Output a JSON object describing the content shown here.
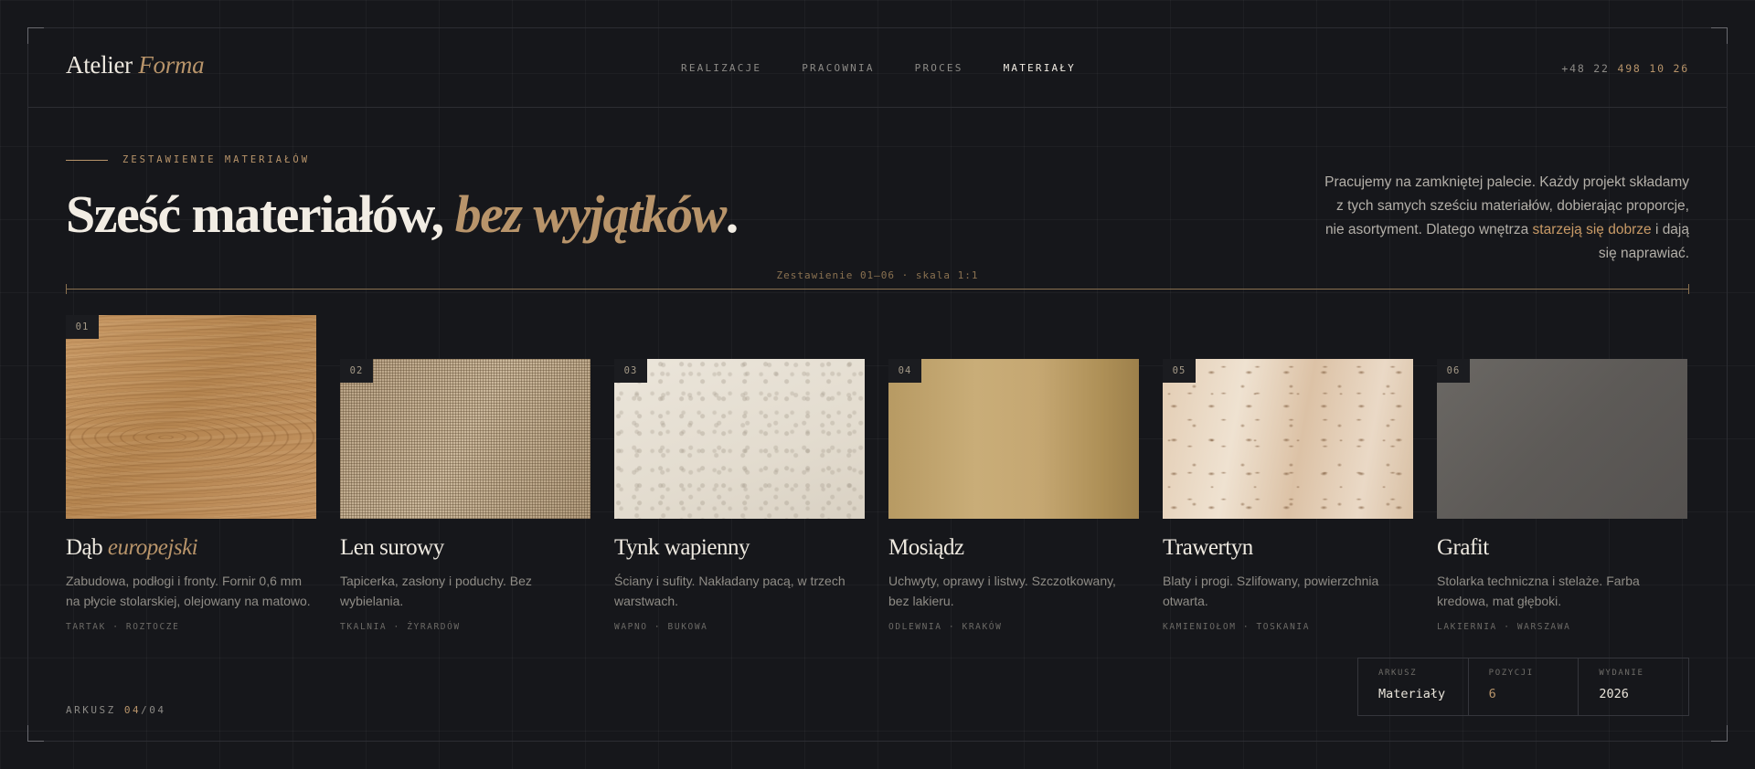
{
  "brand": {
    "name": "Atelier",
    "name_accent": "Forma"
  },
  "nav": {
    "items": [
      {
        "label": "REALIZACJE",
        "active": false
      },
      {
        "label": "PRACOWNIA",
        "active": false
      },
      {
        "label": "PROCES",
        "active": false
      },
      {
        "label": "MATERIAŁY",
        "active": true
      }
    ]
  },
  "phone": {
    "prefix": "+48 22",
    "number": "498 10 26"
  },
  "intro": {
    "eyebrow": "ZESTAWIENIE MATERIAŁÓW",
    "headline_main": "Sześć materiałów,",
    "headline_accent": "bez wyjątków",
    "headline_end": ".",
    "lede_before": "Pracujemy na zamkniętej palecie. Każdy projekt składamy z tych samych sześciu materiałów, dobierając proporcje, nie asortyment. Dlatego wnętrza",
    "lede_accent": "starzeją się dobrze",
    "lede_after": "i dają się naprawiać."
  },
  "ruler": {
    "label": "Zestawienie 01–06 · skala 1:1"
  },
  "materials": [
    {
      "num": "01",
      "title": "Dąb",
      "title_accent": "europejski",
      "desc": "Zabudowa, podłogi i fronty. Fornir 0,6 mm na płycie stolarskiej, olejowany na matowo.",
      "meta": "TARTAK · ROZTOCZE",
      "texture": "oak"
    },
    {
      "num": "02",
      "title": "Len surowy",
      "title_accent": "",
      "desc": "Tapicerka, zasłony i poduchy. Bez wybielania.",
      "meta": "TKALNIA · ŻYRARDÓW",
      "texture": "linen"
    },
    {
      "num": "03",
      "title": "Tynk wapienny",
      "title_accent": "",
      "desc": "Ściany i sufity. Nakładany pacą, w trzech warstwach.",
      "meta": "WAPNO · BUKOWA",
      "texture": "plaster"
    },
    {
      "num": "04",
      "title": "Mosiądz",
      "title_accent": "",
      "desc": "Uchwyty, oprawy i listwy. Szczotkowany, bez lakieru.",
      "meta": "ODLEWNIA · KRAKÓW",
      "texture": "brass"
    },
    {
      "num": "05",
      "title": "Trawertyn",
      "title_accent": "",
      "desc": "Blaty i progi. Szlifowany, powierzchnia otwarta.",
      "meta": "KAMIENIOŁOM · TOSKANIA",
      "texture": "travertine"
    },
    {
      "num": "06",
      "title": "Grafit",
      "title_accent": "",
      "desc": "Stolarka techniczna i stelaże. Farba kredowa, mat głęboki.",
      "meta": "LAKIERNIA · WARSZAWA",
      "texture": "graphite"
    }
  ],
  "footer": {
    "sheet_label": "ARKUSZ",
    "sheet_current": "04",
    "sheet_total": "/04",
    "info": [
      {
        "key": "ARKUSZ",
        "value": "Materiały",
        "accent": false
      },
      {
        "key": "POZYCJI",
        "value": "6",
        "accent": true
      },
      {
        "key": "WYDANIE",
        "value": "2026",
        "accent": false
      }
    ]
  },
  "colors": {
    "background": "#16171b",
    "accent": "#b8946a",
    "text": "#e9e4da",
    "muted": "#8f8c86"
  }
}
